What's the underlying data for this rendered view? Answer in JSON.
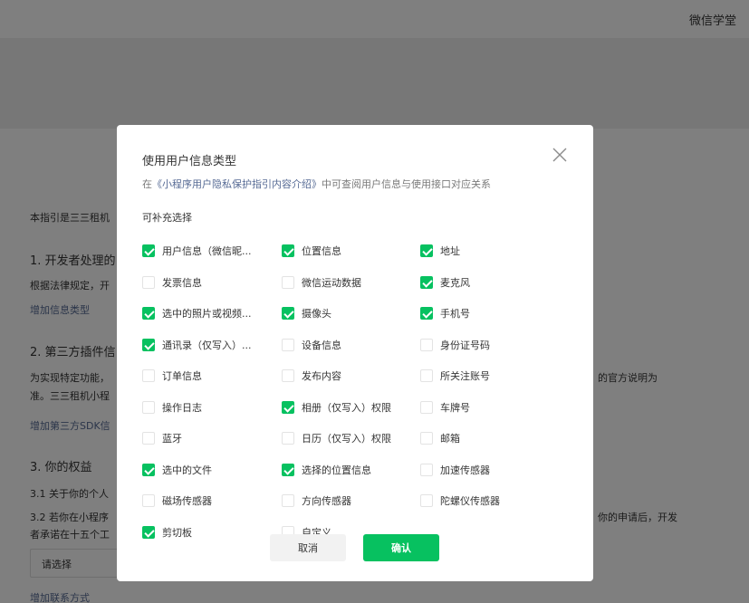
{
  "header": {
    "brand": "微信学堂"
  },
  "page": {
    "intro": "本指引是三三租机",
    "section1_title": "1. 开发者处理的",
    "section1_text": "根据法律规定，开",
    "section1_link": "增加信息类型",
    "section2_title": "2. 第三方插件信",
    "section2_text_a": "为实现特定功能，",
    "section2_text_a_right": "的官方说明为",
    "section2_text_b": "准。三三租机小程",
    "section2_link": "增加第三方SDK信",
    "section3_title": "3. 你的权益",
    "section3_1": "3.1  关于你的个人",
    "section3_2": "3.2  若你在小程序",
    "section3_2_right": "你的申请后，开发",
    "section3_2b": "者承诺在十五个工",
    "select_placeholder": "请选择",
    "contact_link": "增加联系方式"
  },
  "dialog": {
    "title": "使用用户信息类型",
    "desc_prefix": "在",
    "desc_link": "《小程序用户隐私保护指引内容介绍》",
    "desc_suffix": "中可查阅用户信息与使用接口对应关系",
    "section_label": "可补充选择",
    "close_icon": "close-icon",
    "options": [
      {
        "label": "用户信息（微信昵...",
        "checked": true
      },
      {
        "label": "位置信息",
        "checked": true
      },
      {
        "label": "地址",
        "checked": true
      },
      {
        "label": "发票信息",
        "checked": false
      },
      {
        "label": "微信运动数据",
        "checked": false
      },
      {
        "label": "麦克风",
        "checked": true
      },
      {
        "label": "选中的照片或视频...",
        "checked": true
      },
      {
        "label": "摄像头",
        "checked": true
      },
      {
        "label": "手机号",
        "checked": true
      },
      {
        "label": "通讯录（仅写入）...",
        "checked": true
      },
      {
        "label": "设备信息",
        "checked": false
      },
      {
        "label": "身份证号码",
        "checked": false
      },
      {
        "label": "订单信息",
        "checked": false
      },
      {
        "label": "发布内容",
        "checked": false
      },
      {
        "label": "所关注账号",
        "checked": false
      },
      {
        "label": "操作日志",
        "checked": false
      },
      {
        "label": "相册（仅写入）权限",
        "checked": true
      },
      {
        "label": "车牌号",
        "checked": false
      },
      {
        "label": "蓝牙",
        "checked": false
      },
      {
        "label": "日历（仅写入）权限",
        "checked": false
      },
      {
        "label": "邮箱",
        "checked": false
      },
      {
        "label": "选中的文件",
        "checked": true
      },
      {
        "label": "选择的位置信息",
        "checked": true
      },
      {
        "label": "加速传感器",
        "checked": false
      },
      {
        "label": "磁场传感器",
        "checked": false
      },
      {
        "label": "方向传感器",
        "checked": false
      },
      {
        "label": "陀螺仪传感器",
        "checked": false
      },
      {
        "label": "剪切板",
        "checked": true
      },
      {
        "label": "自定义",
        "checked": false
      }
    ],
    "cancel_label": "取消",
    "confirm_label": "确认"
  },
  "colors": {
    "accent": "#07c160",
    "link": "#576b95",
    "mask": "rgba(0,0,0,0.5)"
  }
}
